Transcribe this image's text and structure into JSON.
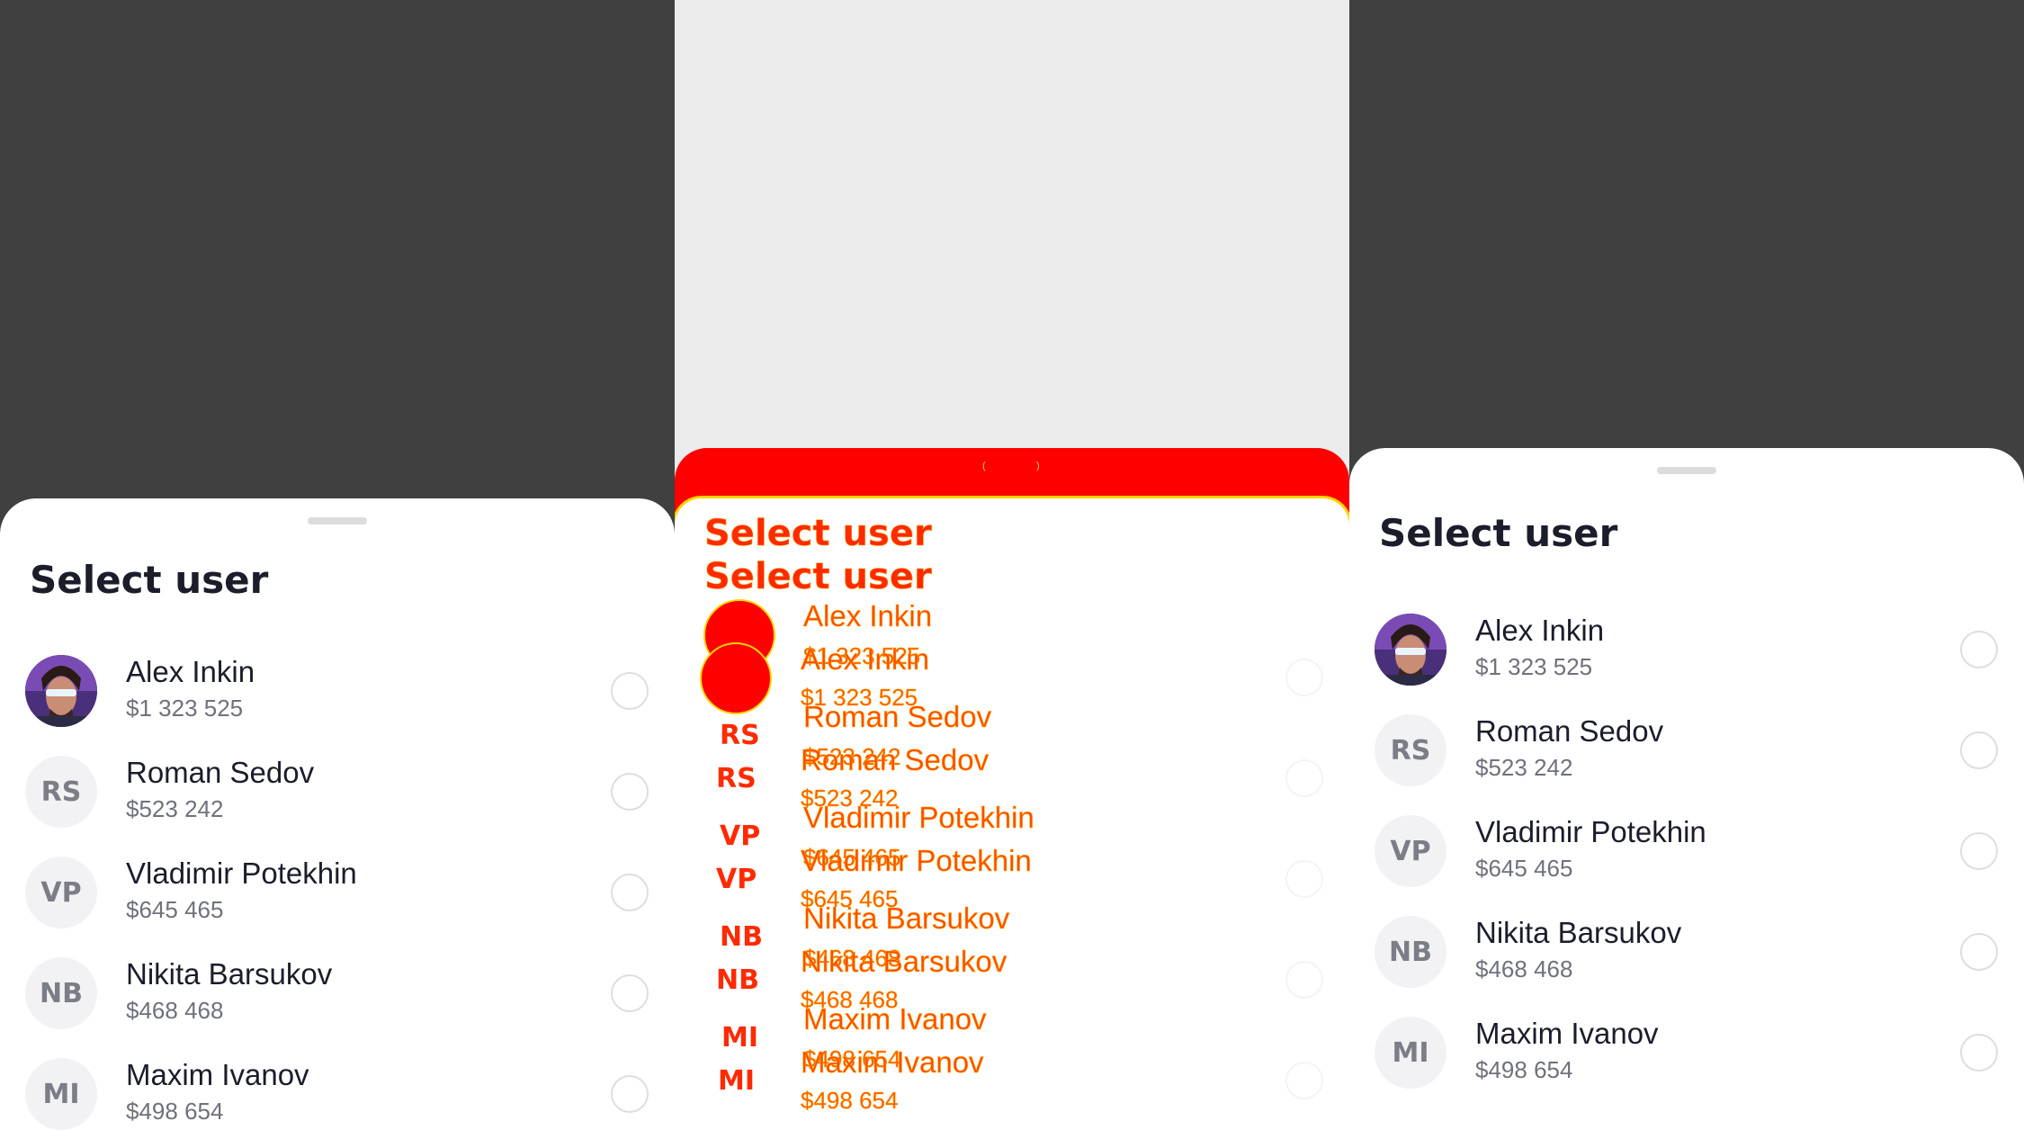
{
  "sheet": {
    "title": "Select user"
  },
  "users": [
    {
      "initials": "",
      "name": "Alex Inkin",
      "amount": "$1 323 525",
      "has_photo": true
    },
    {
      "initials": "RS",
      "name": "Roman Sedov",
      "amount": "$523 242"
    },
    {
      "initials": "VP",
      "name": "Vladimir Potekhin",
      "amount": "$645 465"
    },
    {
      "initials": "NB",
      "name": "Nikita Barsukov",
      "amount": "$468 468"
    },
    {
      "initials": "MI",
      "name": "Maxim Ivanov",
      "amount": "$498 654"
    }
  ],
  "colors": {
    "backdrop": "#404040",
    "sheet": "#ffffff",
    "title": "#1b1d2b",
    "secondary_text": "#6f717c",
    "avatar_bg": "#f2f2f4",
    "overlay_red": "#ff0000",
    "overlay_orange": "#ff9800"
  }
}
